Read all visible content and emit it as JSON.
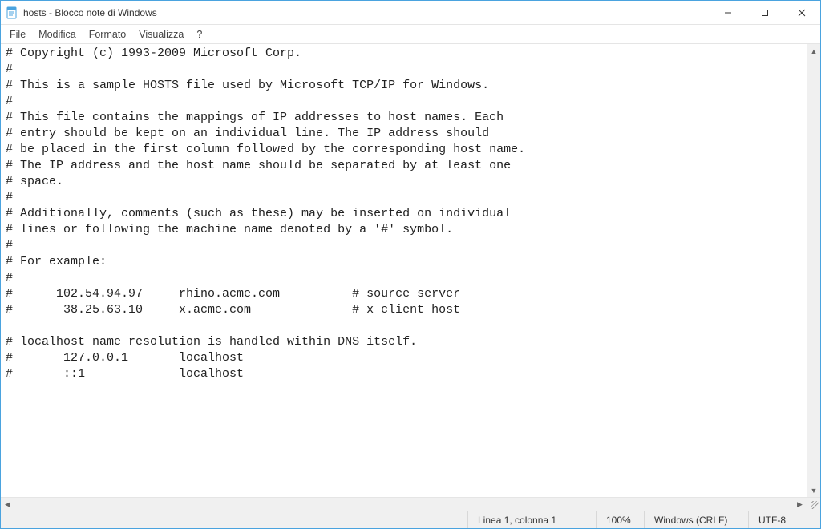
{
  "titlebar": {
    "title": "hosts - Blocco note di Windows"
  },
  "menu": {
    "file": "File",
    "edit": "Modifica",
    "format": "Formato",
    "view": "Visualizza",
    "help": "?"
  },
  "editor": {
    "content": "# Copyright (c) 1993-2009 Microsoft Corp.\n#\n# This is a sample HOSTS file used by Microsoft TCP/IP for Windows.\n#\n# This file contains the mappings of IP addresses to host names. Each\n# entry should be kept on an individual line. The IP address should\n# be placed in the first column followed by the corresponding host name.\n# The IP address and the host name should be separated by at least one\n# space.\n#\n# Additionally, comments (such as these) may be inserted on individual\n# lines or following the machine name denoted by a '#' symbol.\n#\n# For example:\n#\n#      102.54.94.97     rhino.acme.com          # source server\n#       38.25.63.10     x.acme.com              # x client host\n\n# localhost name resolution is handled within DNS itself.\n#       127.0.0.1       localhost\n#       ::1             localhost"
  },
  "status": {
    "position": "Linea 1, colonna 1",
    "zoom": "100%",
    "eol": "Windows (CRLF)",
    "encoding": "UTF-8"
  }
}
